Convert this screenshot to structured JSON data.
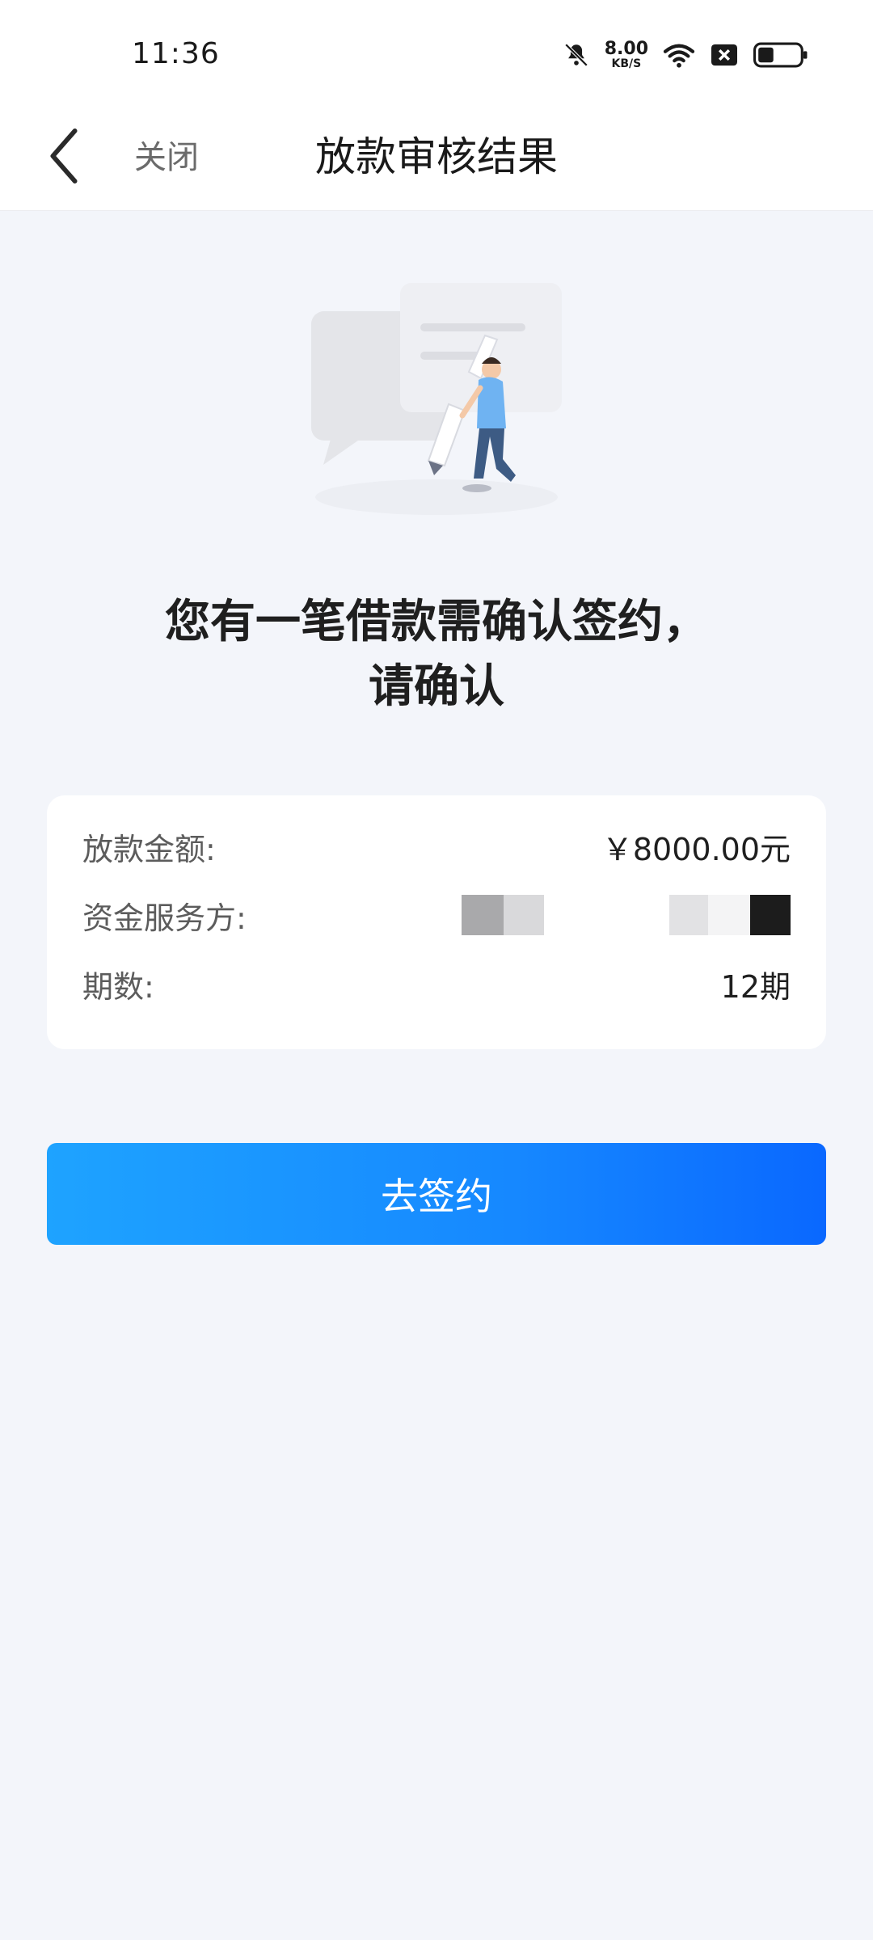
{
  "status_bar": {
    "time": "11:36",
    "net_speed_value": "8.00",
    "net_speed_unit": "KB/S",
    "icons": [
      "bell-muted-icon",
      "wifi-icon",
      "sim-x-icon",
      "battery-icon"
    ]
  },
  "navbar": {
    "back_icon": "chevron-left-icon",
    "close_label": "关闭",
    "title": "放款审核结果"
  },
  "illustration": {
    "icon": "person-with-pen-illustration"
  },
  "headline": {
    "line1": "您有一笔借款需确认签约，",
    "line2": "请确认"
  },
  "details": {
    "amount_label": "放款金额:",
    "amount_value": "￥8000.00元",
    "provider_label": "资金服务方:",
    "term_label": "期数:",
    "term_value": "12期"
  },
  "action": {
    "sign_label": "去签约"
  },
  "colors": {
    "background": "#f3f5fa",
    "card": "#ffffff",
    "button_start": "#1ea3ff",
    "button_end": "#0a68ff",
    "title_text": "#1a1a1a"
  }
}
